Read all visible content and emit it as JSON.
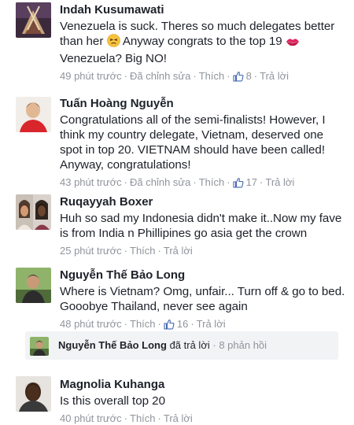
{
  "comments": [
    {
      "name": "Indah Kusumawati",
      "text_a": "Venezuela is suck. Theres so much delegates better than her ",
      "text_b": " Anyway congrats to the top 19 ",
      "text_c": " Venezuela? Big NO!",
      "time": "49 phút trước",
      "edited": "Đã chỉnh sửa",
      "like_label": "Thích",
      "likes": "8",
      "reply_label": "Trả lời"
    },
    {
      "name": "Tuấn Hoàng Nguyễn",
      "text": "Congratulations all of the semi-finalists! However, I think my country delegate, Vietnam, deserved one spot in top 20. VIETNAM should have been called! Anyway, congratulations!",
      "time": "43 phút trước",
      "edited": "Đã chỉnh sửa",
      "like_label": "Thích",
      "likes": "17",
      "reply_label": "Trả lời"
    },
    {
      "name": "Ruqayyah Boxer",
      "text": "Huh so sad my Indonesia didn't make it..Now my fave is from India n Phillipines go asia get the crown",
      "time": "25 phút trước",
      "like_label": "Thích",
      "reply_label": "Trả lời"
    },
    {
      "name": "Nguyễn Thế Bảo Long",
      "text": "Where is Vietnam? Omg, unfair... Turn off & go to bed. Gooobye Thailand, never see again",
      "time": "48 phút trước",
      "like_label": "Thích",
      "likes": "16",
      "reply_label": "Trả lời"
    },
    {
      "name": "Magnolia Kuhanga",
      "text": "Is this overall top 20",
      "time": "40 phút trước",
      "like_label": "Thích",
      "reply_label": "Trả lời"
    }
  ],
  "reply_summary": {
    "name": "Nguyễn Thế Bảo Long",
    "action": "đã trả lời",
    "count": "8 phản hồi"
  },
  "icons": {
    "like": "thumbs-up-icon",
    "emoji_1": "persevering-face-emoji",
    "emoji_2": "kiss-mark-emoji"
  },
  "colors": {
    "link": "#4267b2",
    "meta": "#90949c",
    "text": "#1d2129",
    "reply_bg": "#f2f3f5"
  }
}
